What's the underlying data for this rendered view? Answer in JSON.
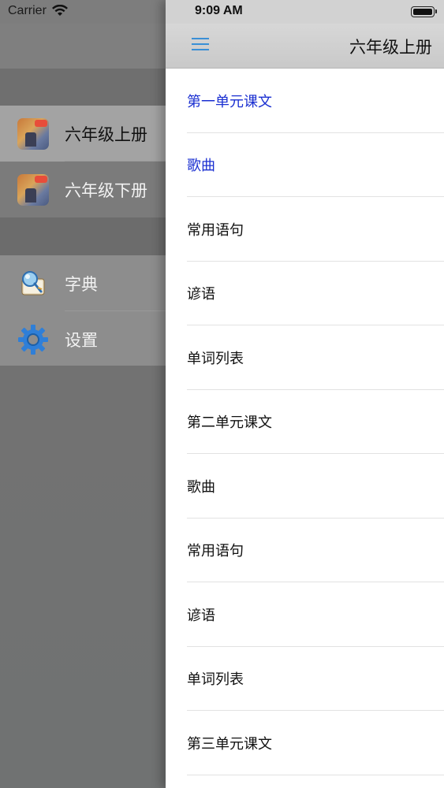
{
  "status_bar": {
    "carrier": "Carrier",
    "time": "9:09 AM",
    "icons": [
      "wifi-icon",
      "battery-icon"
    ]
  },
  "side_menu": {
    "books": [
      {
        "label": "六年级上册",
        "icon": "book-cover-icon",
        "selected": true
      },
      {
        "label": "六年级下册",
        "icon": "book-cover-icon",
        "selected": false
      }
    ],
    "tools": [
      {
        "label": "字典",
        "icon": "dictionary-icon"
      },
      {
        "label": "设置",
        "icon": "gear-icon"
      }
    ]
  },
  "navbar": {
    "title": "六年级上册",
    "menu_icon": "hamburger-menu-icon"
  },
  "lessons": [
    {
      "label": "第一单元课文",
      "linked": true
    },
    {
      "label": "歌曲",
      "linked": true
    },
    {
      "label": "常用语句",
      "linked": false
    },
    {
      "label": "谚语",
      "linked": false
    },
    {
      "label": "单词列表",
      "linked": false
    },
    {
      "label": "第二单元课文",
      "linked": false
    },
    {
      "label": "歌曲",
      "linked": false
    },
    {
      "label": "常用语句",
      "linked": false
    },
    {
      "label": "谚语",
      "linked": false
    },
    {
      "label": "单词列表",
      "linked": false
    },
    {
      "label": "第三单元课文",
      "linked": false
    }
  ],
  "colors": {
    "accent_blue": "#3a8fd6",
    "link_text": "#1a2fd1"
  }
}
